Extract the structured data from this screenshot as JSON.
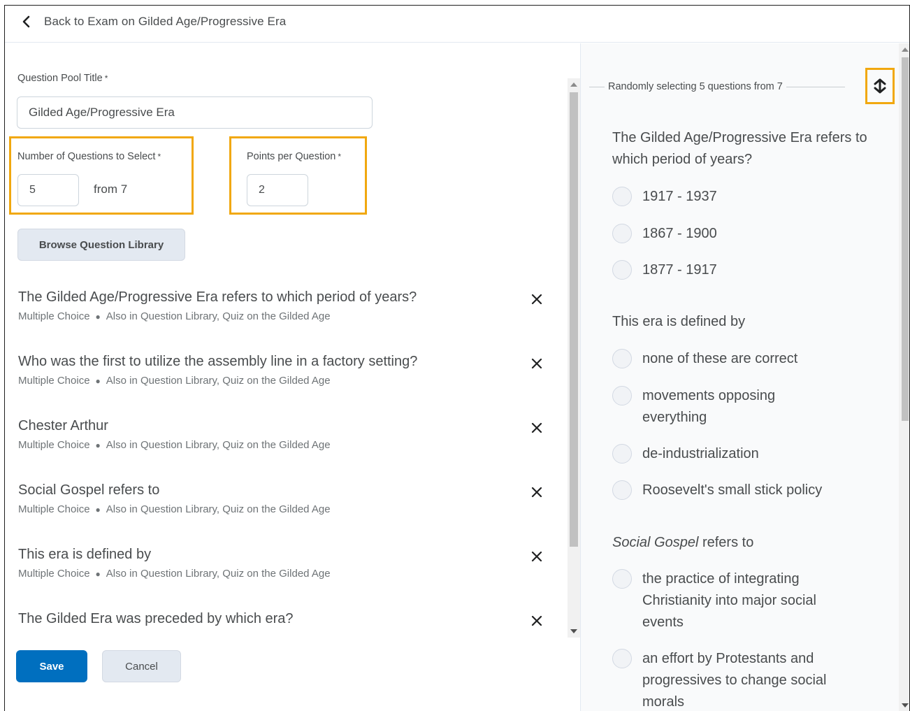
{
  "topbar": {
    "back_label": "Back to Exam on Gilded Age/Progressive Era"
  },
  "form": {
    "pool_title_label": "Question Pool Title",
    "pool_title_value": "Gilded Age/Progressive Era",
    "num_questions_label": "Number of Questions to Select",
    "num_questions_value": "5",
    "from_text": "from 7",
    "points_label": "Points per Question",
    "points_value": "2",
    "required_mark": "*",
    "browse_label": "Browse Question Library"
  },
  "questions": [
    {
      "title": "The Gilded Age/Progressive Era refers to which period of years?",
      "type": "Multiple Choice",
      "also": "Also in Question Library, Quiz on the Gilded Age"
    },
    {
      "title": "Who was the first to utilize the assembly line in a factory setting?",
      "type": "Multiple Choice",
      "also": "Also in Question Library, Quiz on the Gilded Age"
    },
    {
      "title": "Chester Arthur",
      "type": "Multiple Choice",
      "also": "Also in Question Library, Quiz on the Gilded Age"
    },
    {
      "title": "Social Gospel refers to",
      "type": "Multiple Choice",
      "also": "Also in Question Library, Quiz on the Gilded Age"
    },
    {
      "title": "This era is defined by",
      "type": "Multiple Choice",
      "also": "Also in Question Library, Quiz on the Gilded Age"
    },
    {
      "title": "The Gilded Era was preceded by which era?",
      "type": "",
      "also": ""
    }
  ],
  "actions": {
    "save_label": "Save",
    "cancel_label": "Cancel"
  },
  "preview": {
    "header": "Randomly selecting 5 questions from 7",
    "items": [
      {
        "title": "The Gilded Age/Progressive Era refers to which period of years?",
        "options": [
          "1917 - 1937",
          "1867 - 1900",
          "1877 - 1917"
        ]
      },
      {
        "title": "This era is defined by",
        "options": [
          "none of these are correct",
          "movements opposing everything",
          "de-industrialization",
          "Roosevelt's small stick policy"
        ]
      },
      {
        "title_italic": "Social Gospel",
        "title_rest": " refers to",
        "options": [
          "the practice of integrating Christianity into major social events",
          "an effort by Protestants and progressives to change social morals"
        ]
      }
    ]
  },
  "colors": {
    "primary": "#006fbf",
    "highlight": "#f1a80f",
    "secondary_button": "#e3e9f1",
    "text": "#494c4e"
  },
  "icons": {
    "back": "chevron-left-icon",
    "remove": "close-icon",
    "shuffle": "shuffle-icon"
  }
}
